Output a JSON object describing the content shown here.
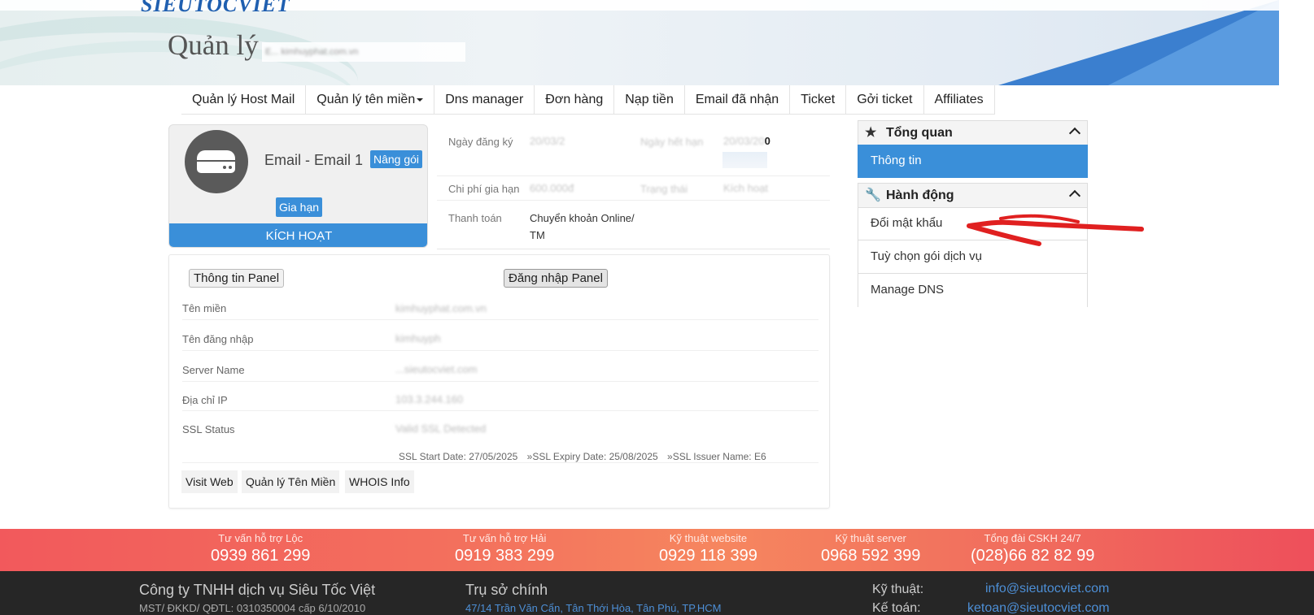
{
  "brand": {
    "logo_text": "SIEUTOCVIET"
  },
  "header": {
    "title": "Quản lý",
    "title_hidden_text": "E... kimhuyphat.com.vn"
  },
  "nav": {
    "items": [
      {
        "label": "Quản lý Host Mail"
      },
      {
        "label": "Quản lý tên miền"
      },
      {
        "label": "Dns manager"
      },
      {
        "label": "Đơn hàng"
      },
      {
        "label": "Nạp tiền"
      },
      {
        "label": "Email đã nhận"
      },
      {
        "label": "Ticket"
      },
      {
        "label": "Gởi ticket"
      },
      {
        "label": "Affiliates"
      }
    ]
  },
  "service": {
    "name": "Email - Email 1",
    "upgrade_label": "Nâng gói",
    "renew_label": "Gia hạn",
    "status_label": "KÍCH HOẠT"
  },
  "info": {
    "reg_date_label": "Ngày đăng ký",
    "reg_date_value": "20/03/2",
    "due_label": "Ngày hết hạn",
    "due_value": "20/03/20",
    "due_suffix": "0",
    "renew_cost_label": "Chi phí gia hạn",
    "renew_cost_value": "600.000đ",
    "status_label": "Trạng thái",
    "status_value": "Kích hoạt",
    "payment_label": "Thanh toán",
    "payment_value_1": "Chuyển khoản Online/",
    "payment_value_2": "TM"
  },
  "detail": {
    "panel_info_btn": "Thông tin Panel",
    "panel_login_btn": "Đăng nhập Panel",
    "rows": [
      {
        "label": "Tên miền",
        "value": "kimhuyphat.com.vn"
      },
      {
        "label": "Tên đăng nhập",
        "value": "kimhuyph"
      },
      {
        "label": "Server Name",
        "value": "...sieutocviet.com"
      },
      {
        "label": "Địa chỉ IP",
        "value": "103.3.244.160"
      },
      {
        "label": "SSL Status",
        "value": "Valid SSL Detected"
      }
    ],
    "ssl_start": "SSL Start Date: 27/05/2025",
    "ssl_expiry": "»SSL Expiry Date: 25/08/2025",
    "ssl_issuer": "»SSL Issuer Name: E6",
    "buttons": {
      "visit_web": "Visit Web",
      "manage_domain": "Quản lý Tên Miền",
      "whois": "WHOIS Info"
    }
  },
  "sidebar": {
    "overview_title": "Tổng quan",
    "overview_items": [
      {
        "label": "Thông tin"
      }
    ],
    "actions_title": "Hành động",
    "action_items": [
      {
        "label": "Đổi mật khẩu"
      },
      {
        "label": "Tuỳ chọn gói dịch vụ"
      },
      {
        "label": "Manage DNS"
      }
    ]
  },
  "annotation": {
    "arrow_color": "#e02020"
  },
  "hotlines": [
    {
      "title": "Tư vấn hỗ trợ Lộc",
      "number": "0939 861 299"
    },
    {
      "title": "Tư vấn hỗ trợ Hải",
      "number": "0919 383 299"
    },
    {
      "title": "Kỹ thuật website",
      "number": "0929 118 399"
    },
    {
      "title": "Kỹ thuật server",
      "number": "0968 592 399"
    },
    {
      "title": "Tổng đài CSKH 24/7",
      "number": "(028)66 82 82 99"
    }
  ],
  "footer": {
    "company": "Công ty TNHH dịch vụ Siêu Tốc Việt",
    "mst": "MST/ ĐKKD/ QĐTL: 0310350004 cấp 6/10/2010",
    "hq_title": "Trụ sở chính",
    "hq_address": "47/14 Trần Văn Cẩn, Tân Thới Hòa, Tân Phú, TP.HCM",
    "tech_label": "Kỹ thuật:",
    "tech_email": "info@sieutocviet.com",
    "acct_label": "Kế toán:",
    "acct_email": "ketoan@sieutocviet.com"
  },
  "colors": {
    "primary": "#3a8fd9",
    "footer_bg": "#262626",
    "hotline_bg": "#f3705d",
    "link": "#4d8fd6"
  }
}
